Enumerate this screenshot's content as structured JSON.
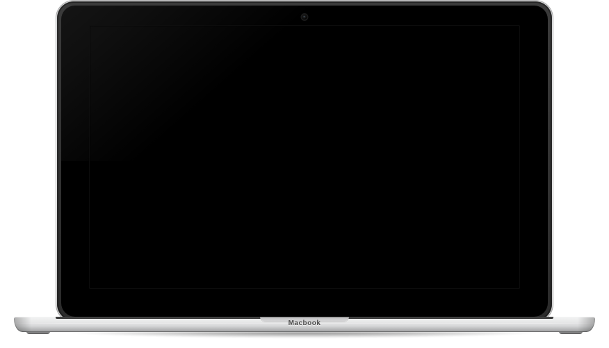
{
  "device": {
    "brand_label": "Macbook"
  }
}
